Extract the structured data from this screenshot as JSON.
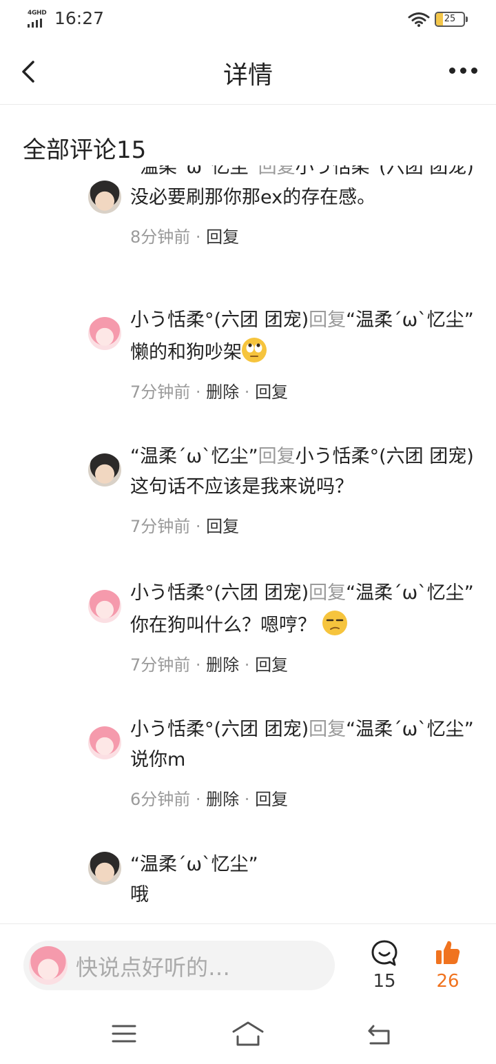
{
  "status_bar": {
    "network": "4GHD",
    "time": "16:27",
    "battery": "25",
    "battery_level": 0.25
  },
  "header": {
    "title": "详情"
  },
  "comments_header": "全部评论15",
  "comments": [
    {
      "avatar": "boy",
      "author": "“温柔ˊωˋ忆尘”",
      "verb": "回复",
      "target": "小う恬柔°(六团 团宠)",
      "text": "没必要刷那你那ex的存在感。",
      "time": "8分钟前",
      "actions": [
        "回复"
      ]
    },
    {
      "avatar": "girl",
      "author": "小う恬柔°(六团 团宠)",
      "verb": "回复",
      "target": "“温柔ˊωˋ忆尘”",
      "text": "懒的和狗吵架",
      "emoji": "rolling-eyes-emoji",
      "time": "7分钟前",
      "actions": [
        "删除",
        "回复"
      ]
    },
    {
      "avatar": "boy",
      "author": "“温柔ˊωˋ忆尘”",
      "verb": "回复",
      "target": "小う恬柔°(六团 团宠)",
      "text": "这句话不应该是我来说吗？",
      "time": "7分钟前",
      "actions": [
        "回复"
      ]
    },
    {
      "avatar": "girl",
      "author": "小う恬柔°(六团 团宠)",
      "verb": "回复",
      "target": "“温柔ˊωˋ忆尘”",
      "text": "你在狗叫什么？嗯哼？",
      "emoji": "unamused-emoji",
      "time": "7分钟前",
      "actions": [
        "删除",
        "回复"
      ]
    },
    {
      "avatar": "girl",
      "author": "小う恬柔°(六团 团宠)",
      "verb": "回复",
      "target": "“温柔ˊωˋ忆尘”",
      "text": "说你m",
      "time": "6分钟前",
      "actions": [
        "删除",
        "回复"
      ]
    },
    {
      "avatar": "boy",
      "author": "“温柔ˊωˋ忆尘”",
      "verb": "",
      "target": "",
      "text": "哦",
      "time": "",
      "actions": []
    }
  ],
  "bottom_bar": {
    "placeholder": "快说点好听的…",
    "comment_count": "15",
    "like_count": "26",
    "like_color": "#f0731f"
  },
  "icons": [
    "back-arrow-icon",
    "more-dots-icon",
    "comment-bubble-icon",
    "thumbs-up-icon",
    "menu-lines-icon",
    "home-icon",
    "back-return-icon"
  ]
}
